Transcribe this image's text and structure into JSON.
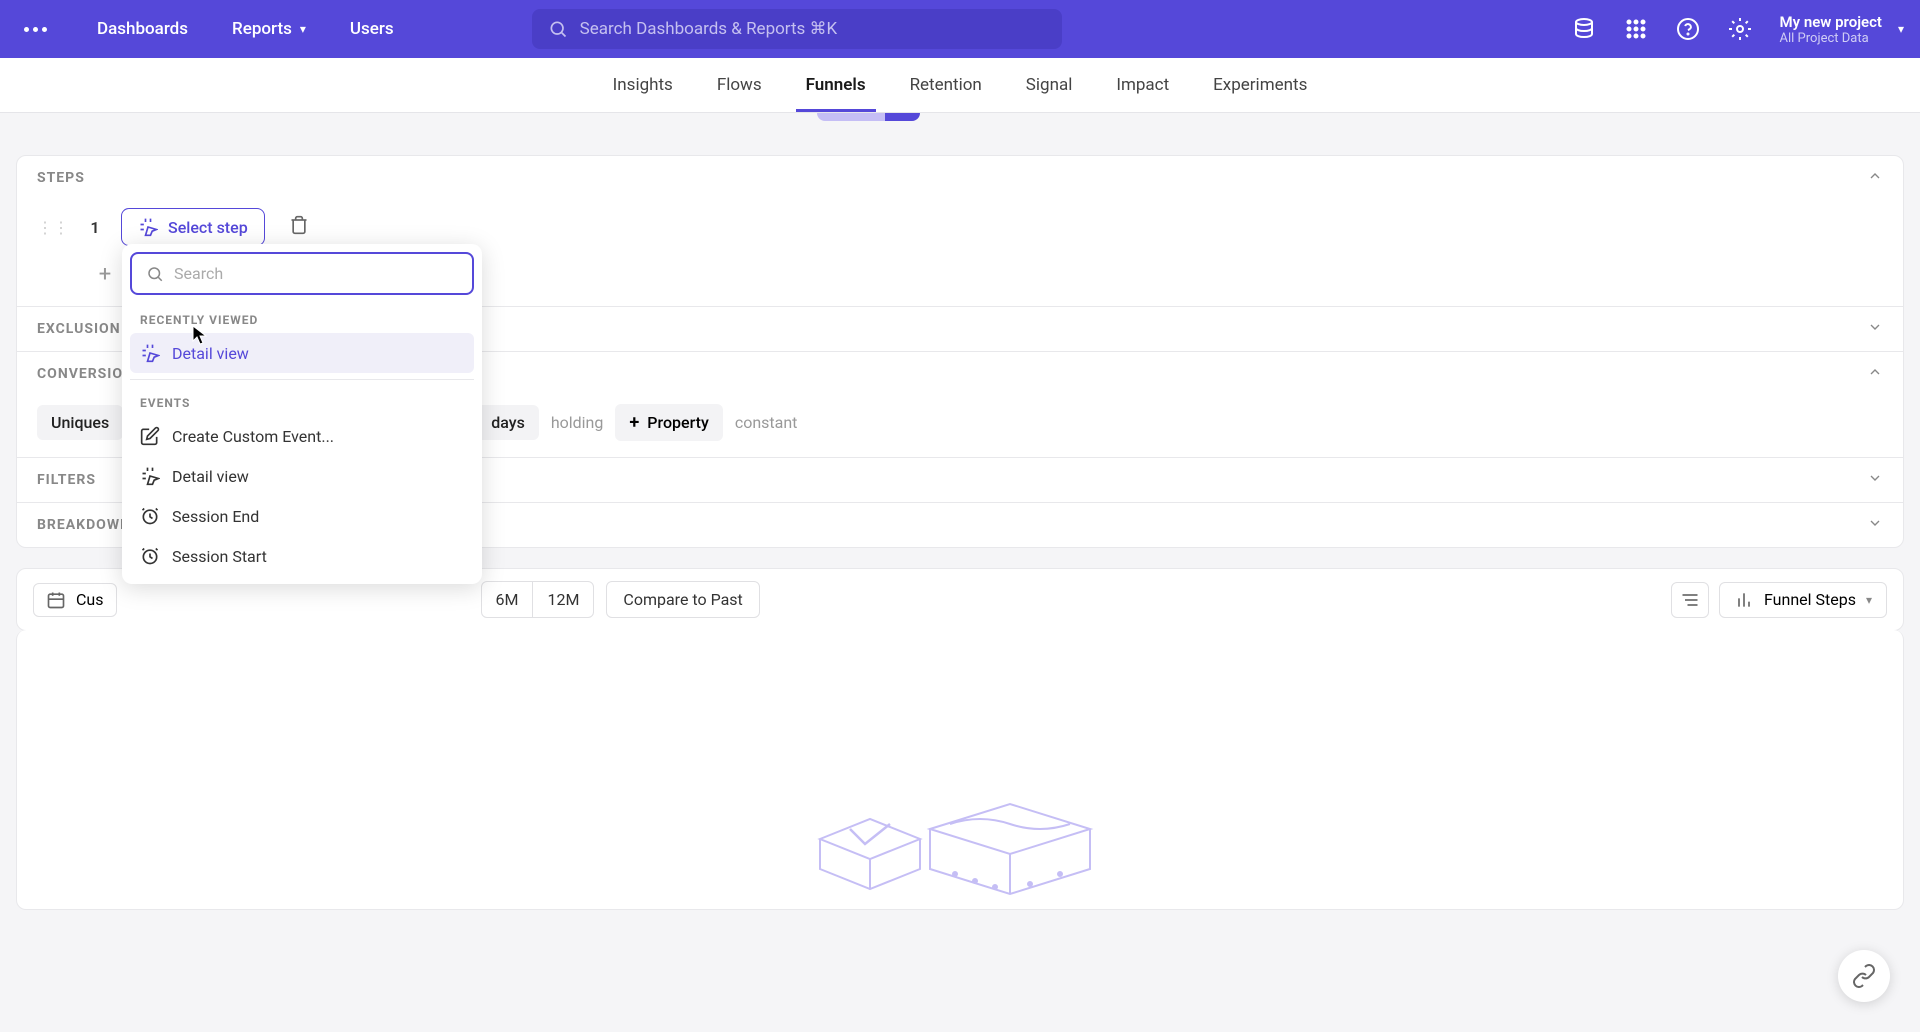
{
  "topbar": {
    "nav": {
      "dashboards": "Dashboards",
      "reports": "Reports",
      "users": "Users"
    },
    "search_placeholder": "Search Dashboards & Reports ⌘K",
    "project": {
      "name": "My new project",
      "subtitle": "All Project Data"
    }
  },
  "tabs": {
    "insights": "Insights",
    "flows": "Flows",
    "funnels": "Funnels",
    "retention": "Retention",
    "signal": "Signal",
    "impact": "Impact",
    "experiments": "Experiments"
  },
  "sections": {
    "steps": "STEPS",
    "exclusion": "EXCLUSION STEPS",
    "conversion": "CONVERSION CRITERIA",
    "filters": "FILTERS",
    "breakdowns": "BREAKDOWNS"
  },
  "steps": {
    "number": "1",
    "select_step": "Select step"
  },
  "dropdown": {
    "search_placeholder": "Search",
    "recently_viewed": "RECENTLY VIEWED",
    "events": "EVENTS",
    "items": {
      "detail_view": "Detail view",
      "create_custom": "Create Custom Event...",
      "detail_view2": "Detail view",
      "session_end": "Session End",
      "session_start": "Session Start"
    }
  },
  "conversion": {
    "uniques": "Uniques",
    "days": "days",
    "holding": "holding",
    "property": "Property",
    "constant": "constant"
  },
  "toolbar": {
    "custom": "Cus",
    "ranges": {
      "6m": "6M",
      "12m": "12M"
    },
    "compare": "Compare to Past",
    "funnel_steps": "Funnel Steps"
  }
}
